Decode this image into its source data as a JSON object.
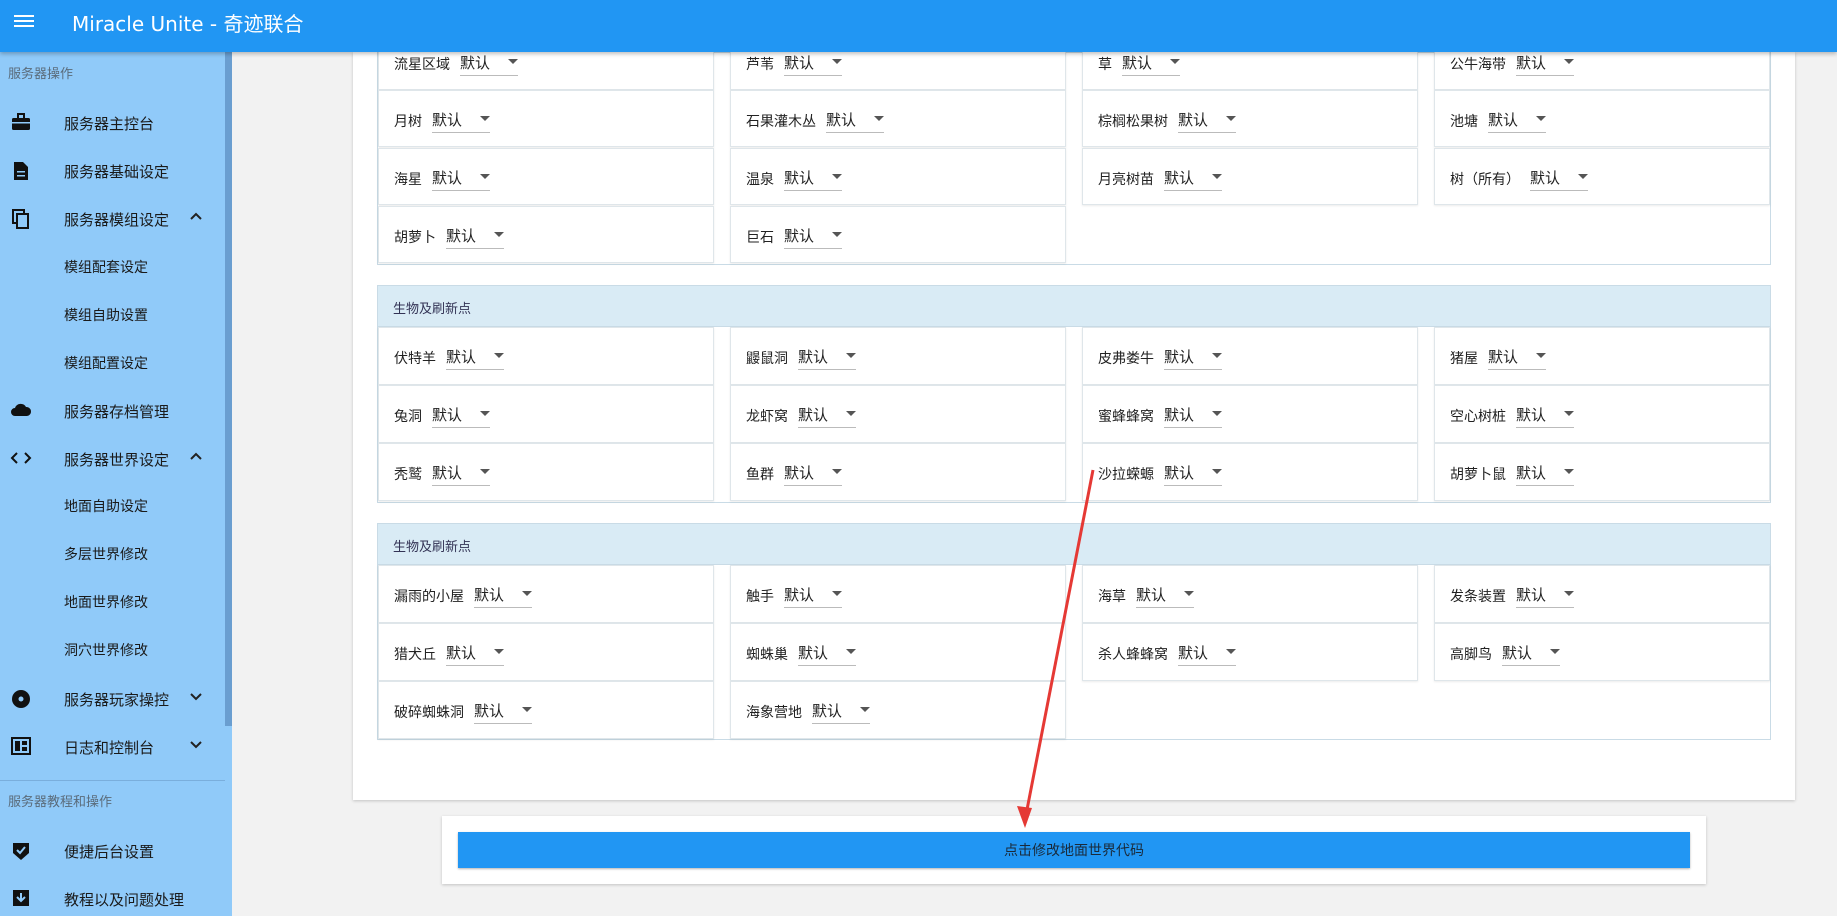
{
  "app": {
    "title": "Miracle Unite - 奇迹联合"
  },
  "sidebar": {
    "section1": "服务器操作",
    "items": [
      {
        "label": "服务器主控台",
        "icon": "briefcase-icon"
      },
      {
        "label": "服务器基础设定",
        "icon": "document-icon"
      },
      {
        "label": "服务器模组设定",
        "icon": "copy-icon",
        "arrow": "expand-less"
      },
      {
        "label": "模组配套设定"
      },
      {
        "label": "模组自助设置"
      },
      {
        "label": "模组配置设定"
      },
      {
        "label": "服务器存档管理",
        "icon": "cloud-icon"
      },
      {
        "label": "服务器世界设定",
        "icon": "code-icon",
        "arrow": "expand-less"
      },
      {
        "label": "地面自助设定"
      },
      {
        "label": "多层世界修改"
      },
      {
        "label": "地面世界修改"
      },
      {
        "label": "洞穴世界修改"
      },
      {
        "label": "服务器玩家操控",
        "icon": "disc-icon",
        "arrow": "expand-more"
      },
      {
        "label": "日志和控制台",
        "icon": "dashboard-icon",
        "arrow": "expand-more"
      }
    ],
    "section2": "服务器教程和操作",
    "items2": [
      {
        "label": "便捷后台设置",
        "icon": "verified-icon"
      },
      {
        "label": "教程以及问题处理",
        "icon": "download-box-icon"
      }
    ]
  },
  "default_value": "默认",
  "section_top": {
    "rows": [
      [
        "流星区域",
        "芦苇",
        "草",
        "公牛海带"
      ],
      [
        "月树",
        "石果灌木丛",
        "棕榈松果树",
        "池塘"
      ],
      [
        "海星",
        "温泉",
        "月亮树苗",
        "树（所有）"
      ],
      [
        "胡萝卜",
        "巨石"
      ]
    ]
  },
  "section_mid": {
    "header": "生物及刷新点",
    "rows": [
      [
        "伏特羊",
        "鼹鼠洞",
        "皮弗娄牛",
        "猪屋"
      ],
      [
        "兔洞",
        "龙虾窝",
        "蜜蜂蜂窝",
        "空心树桩"
      ],
      [
        "秃鹫",
        "鱼群",
        "沙拉蝾螈",
        "胡萝卜鼠"
      ]
    ]
  },
  "section_bottom": {
    "header": "生物及刷新点",
    "rows": [
      [
        "漏雨的小屋",
        "触手",
        "海草",
        "发条装置"
      ],
      [
        "猎犬丘",
        "蜘蛛巢",
        "杀人蜂蜂窝",
        "高脚鸟"
      ],
      [
        "破碎蜘蛛洞",
        "海象营地"
      ]
    ]
  },
  "action": {
    "button_label": "点击修改地面世界代码"
  },
  "colors": {
    "appbar": "#2196f3",
    "sidebar": "#90caf9",
    "section_header": "#d9ebf5",
    "arrow": "#e53935"
  }
}
